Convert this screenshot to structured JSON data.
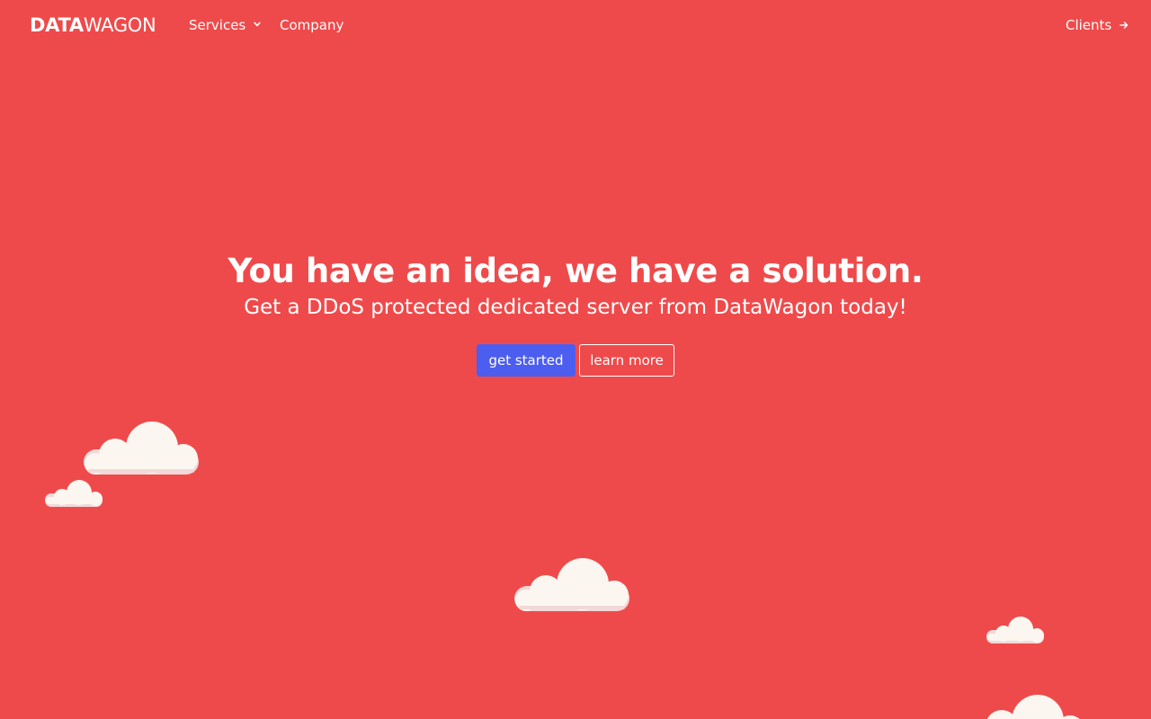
{
  "brand": {
    "bold": "DATA",
    "light": "WAGON"
  },
  "nav": {
    "services": "Services",
    "company": "Company",
    "clients": "Clients"
  },
  "hero": {
    "title": "You have an idea, we have a solution.",
    "subtitle": "Get a DDoS protected dedicated server from DataWagon today!",
    "primary_button": "get started",
    "secondary_button": "learn more"
  },
  "icons": {
    "services_dropdown": "chevron-down-icon",
    "clients_link": "arrow-right-icon"
  },
  "colors": {
    "background": "#ef4a4b",
    "primary_button": "#4c5ef0",
    "cloud": "#fbf6f0",
    "cloud_shade": "#f2d8d8"
  }
}
